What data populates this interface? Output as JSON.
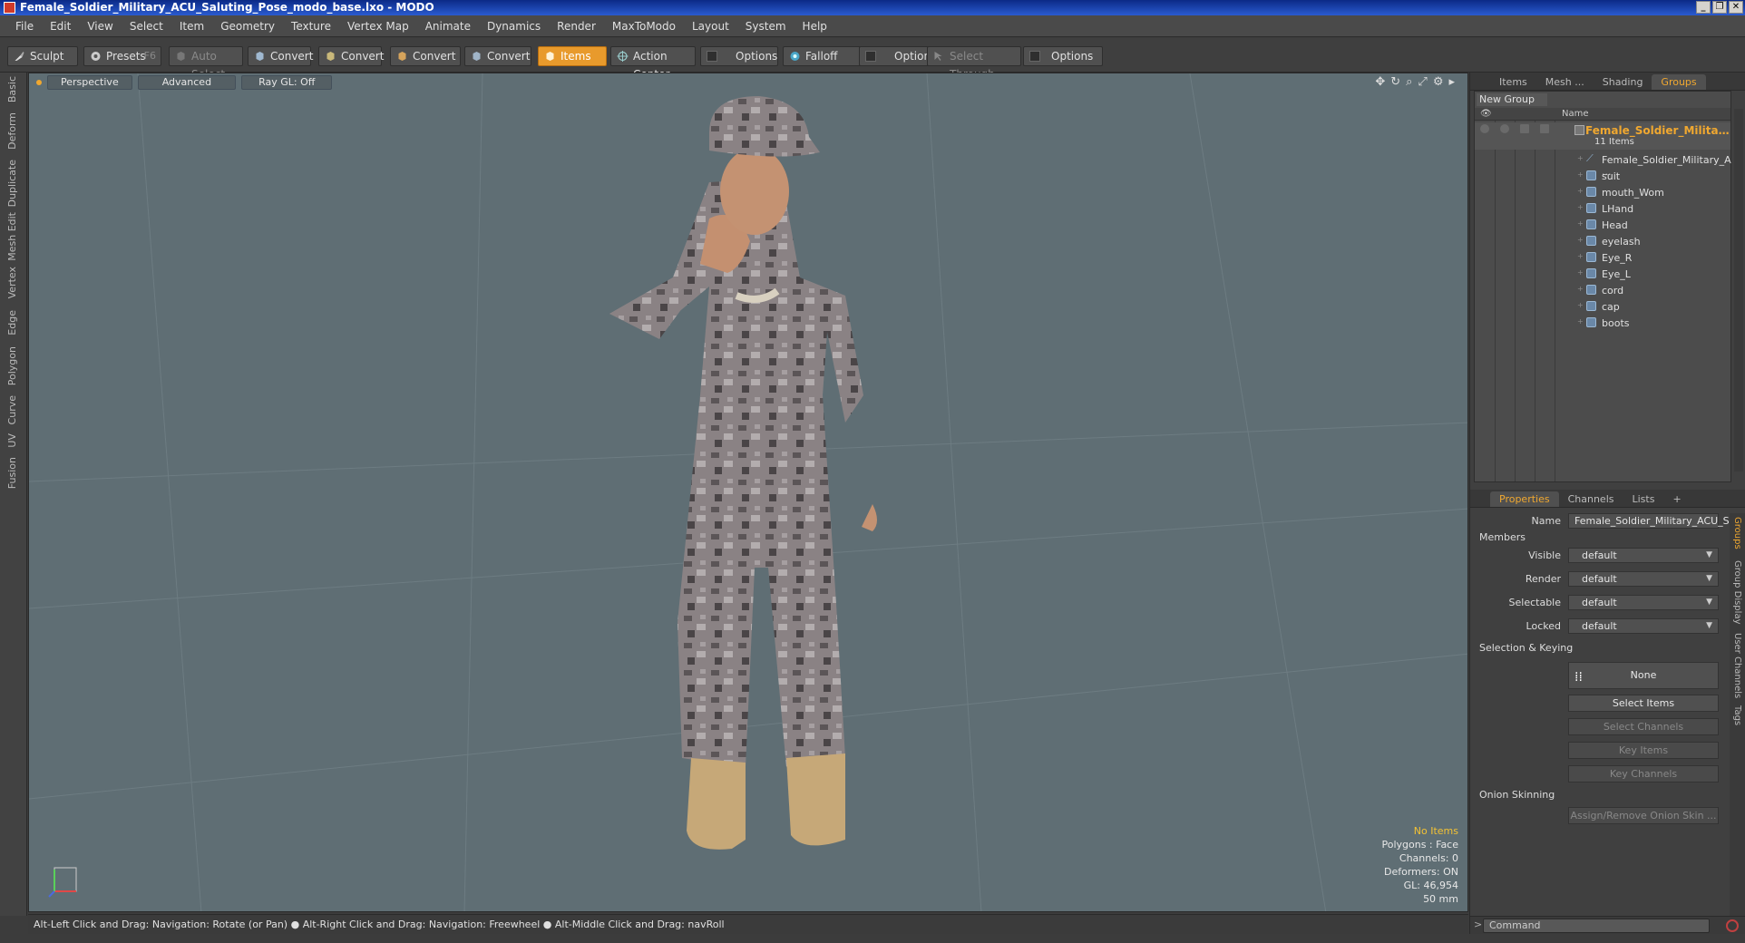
{
  "window": {
    "title": "Female_Soldier_Military_ACU_Saluting_Pose_modo_base.lxo - MODO",
    "buttons": [
      "_",
      "❐",
      "✕"
    ]
  },
  "menu": [
    "File",
    "Edit",
    "View",
    "Select",
    "Item",
    "Geometry",
    "Texture",
    "Vertex Map",
    "Animate",
    "Dynamics",
    "Render",
    "MaxToModo",
    "Layout",
    "System",
    "Help"
  ],
  "toolbar": {
    "sculpt": "Sculpt",
    "presets": "Presets",
    "presets_key": "F6",
    "auto_select": "Auto Select",
    "convert1": "Convert",
    "convert2": "Convert",
    "convert3": "Convert",
    "convert4": "Convert",
    "items": "Items",
    "action_center": "Action Center",
    "options1": "Options",
    "falloff": "Falloff",
    "options2": "Options",
    "select_through": "Select Through",
    "options3": "Options"
  },
  "left_tabs": [
    "Basic",
    "Deform",
    "Duplicate",
    "Mesh Edit",
    "Vertex",
    "Edge",
    "Polygon",
    "Curve",
    "UV",
    "Fusion"
  ],
  "viewport": {
    "perspective": "Perspective",
    "advanced": "Advanced",
    "raygl": "Ray GL: Off",
    "info": {
      "no_items": "No Items",
      "polygons": "Polygons : Face",
      "channels": "Channels: 0",
      "deformers": "Deformers: ON",
      "gl": "GL: 46,954",
      "scale": "50 mm"
    }
  },
  "status": "Alt-Left Click and Drag: Navigation: Rotate (or Pan) ● Alt-Right Click and Drag: Navigation: Freewheel ● Alt-Middle Click and Drag: navRoll",
  "right_tabs_top": [
    "Items",
    "Mesh ...",
    "Shading",
    "Groups"
  ],
  "groups": {
    "new_group": "New Group",
    "col_name": "Name",
    "root_name": "Female_Soldier_Military ...",
    "root_count": "11 Items",
    "children": [
      "Female_Soldier_Military_A ...",
      "suit",
      "mouth_Wom",
      "LHand",
      "Head",
      "eyelash",
      "Eye_R",
      "Eye_L",
      "cord",
      "cap",
      "boots"
    ]
  },
  "right_tabs_bottom": [
    "Properties",
    "Channels",
    "Lists",
    "+"
  ],
  "properties": {
    "name_label": "Name",
    "name_value": "Female_Soldier_Military_ACU_Sa",
    "members": "Members",
    "visible_label": "Visible",
    "visible_value": "default",
    "render_label": "Render",
    "render_value": "default",
    "selectable_label": "Selectable",
    "selectable_value": "default",
    "locked_label": "Locked",
    "locked_value": "default",
    "selection_keying": "Selection & Keying",
    "none": "None",
    "select_items": "Select Items",
    "select_channels": "Select Channels",
    "key_items": "Key Items",
    "key_channels": "Key Channels",
    "onion_skinning": "Onion Skinning",
    "assign_onion": "Assign/Remove Onion Skin ..."
  },
  "props_side_tabs": [
    "Groups",
    "Group Display",
    "User Channels",
    "Tags"
  ],
  "command": {
    "prompt": ">",
    "placeholder": "Command"
  }
}
